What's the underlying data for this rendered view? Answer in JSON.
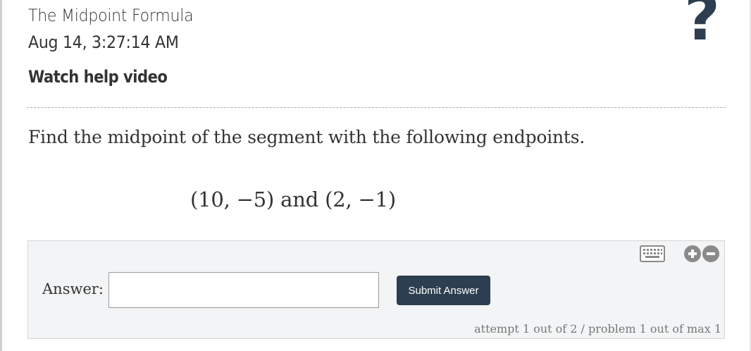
{
  "header": {
    "title": "The Midpoint Formula",
    "timestamp": "Aug 14, 3:27:14 AM",
    "help_link": "Watch help video",
    "help_icon": "question-mark-icon",
    "help_icon_glyph": "?"
  },
  "problem": {
    "prompt": "Find the midpoint of the segment with the following endpoints.",
    "expression": "(10, −5) and (2, −1)"
  },
  "answer": {
    "label": "Answer:",
    "input_value": "",
    "submit_label": "Submit Answer",
    "attempt_info": "attempt 1 out of 2 / problem 1 out of max 1",
    "toolbar_icons": [
      "keyboard-icon",
      "plus-circle-icon",
      "minus-circle-icon"
    ]
  },
  "colors": {
    "accent": "#2c3e50",
    "text": "#333333",
    "answer_bg": "#f3f4f5",
    "muted": "#777777",
    "icon_gray": "#8a8a8a"
  }
}
